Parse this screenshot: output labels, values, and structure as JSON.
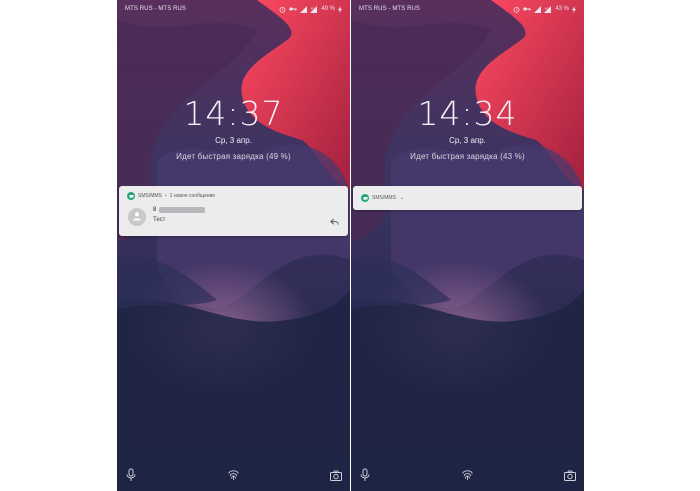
{
  "screens": [
    {
      "status_bar": {
        "carrier": "MTS RUS - MTS RUS",
        "battery": "49 %"
      },
      "clock": "14:37",
      "date": "Ср, 3 апр.",
      "charging": "Идет быстрая зарядка (49 %)",
      "notification": {
        "app_name": "SMS/MMS",
        "separator": "•",
        "summary": "1 новое сообщение",
        "sender": "8",
        "message": "Тест"
      }
    },
    {
      "status_bar": {
        "carrier": "MTS RUS - MTS RUS",
        "battery": "43 %"
      },
      "clock": "14:34",
      "date": "Ср, 3 апр.",
      "charging": "Идет быстрая зарядка (43 %)",
      "notification": {
        "app_name": "SMS/MMS",
        "chevron": "⌄"
      }
    }
  ],
  "icons": {
    "status": [
      "alarm-icon",
      "key-icon",
      "signal-icon",
      "signal-icon",
      "charging-bolt-icon"
    ],
    "notification": [
      "sms-app-icon",
      "person-icon",
      "reply-icon"
    ],
    "lockscreen_bottom": [
      "microphone-icon",
      "fingerprint-icon",
      "camera-icon"
    ]
  },
  "colors": {
    "wallpaper_dark": "#252a4a",
    "wallpaper_red": "#e23a5a",
    "wallpaper_purple": "#7a4a7c",
    "notification_bg": "#ececec",
    "app_accent": "#1fa67a"
  }
}
